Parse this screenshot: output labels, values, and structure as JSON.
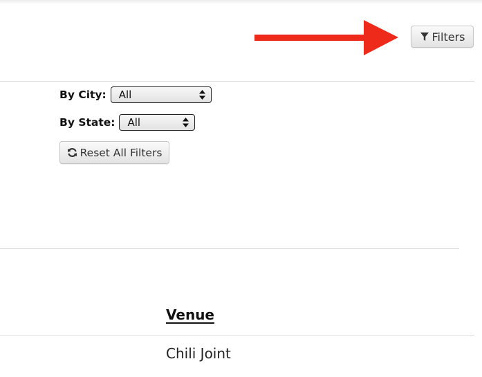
{
  "toolbar": {
    "filters_label": "Filters",
    "filters_icon": "funnel-icon",
    "annotation_color": "#ee2a1b"
  },
  "filters": {
    "city": {
      "label": "By City:",
      "selected": "All"
    },
    "state": {
      "label": "By State:",
      "selected": "All"
    },
    "reset_label": "Reset All Filters",
    "reset_icon": "refresh-icon"
  },
  "table": {
    "columns": [
      "Venue"
    ],
    "rows": [
      [
        "Chili Joint"
      ]
    ]
  }
}
